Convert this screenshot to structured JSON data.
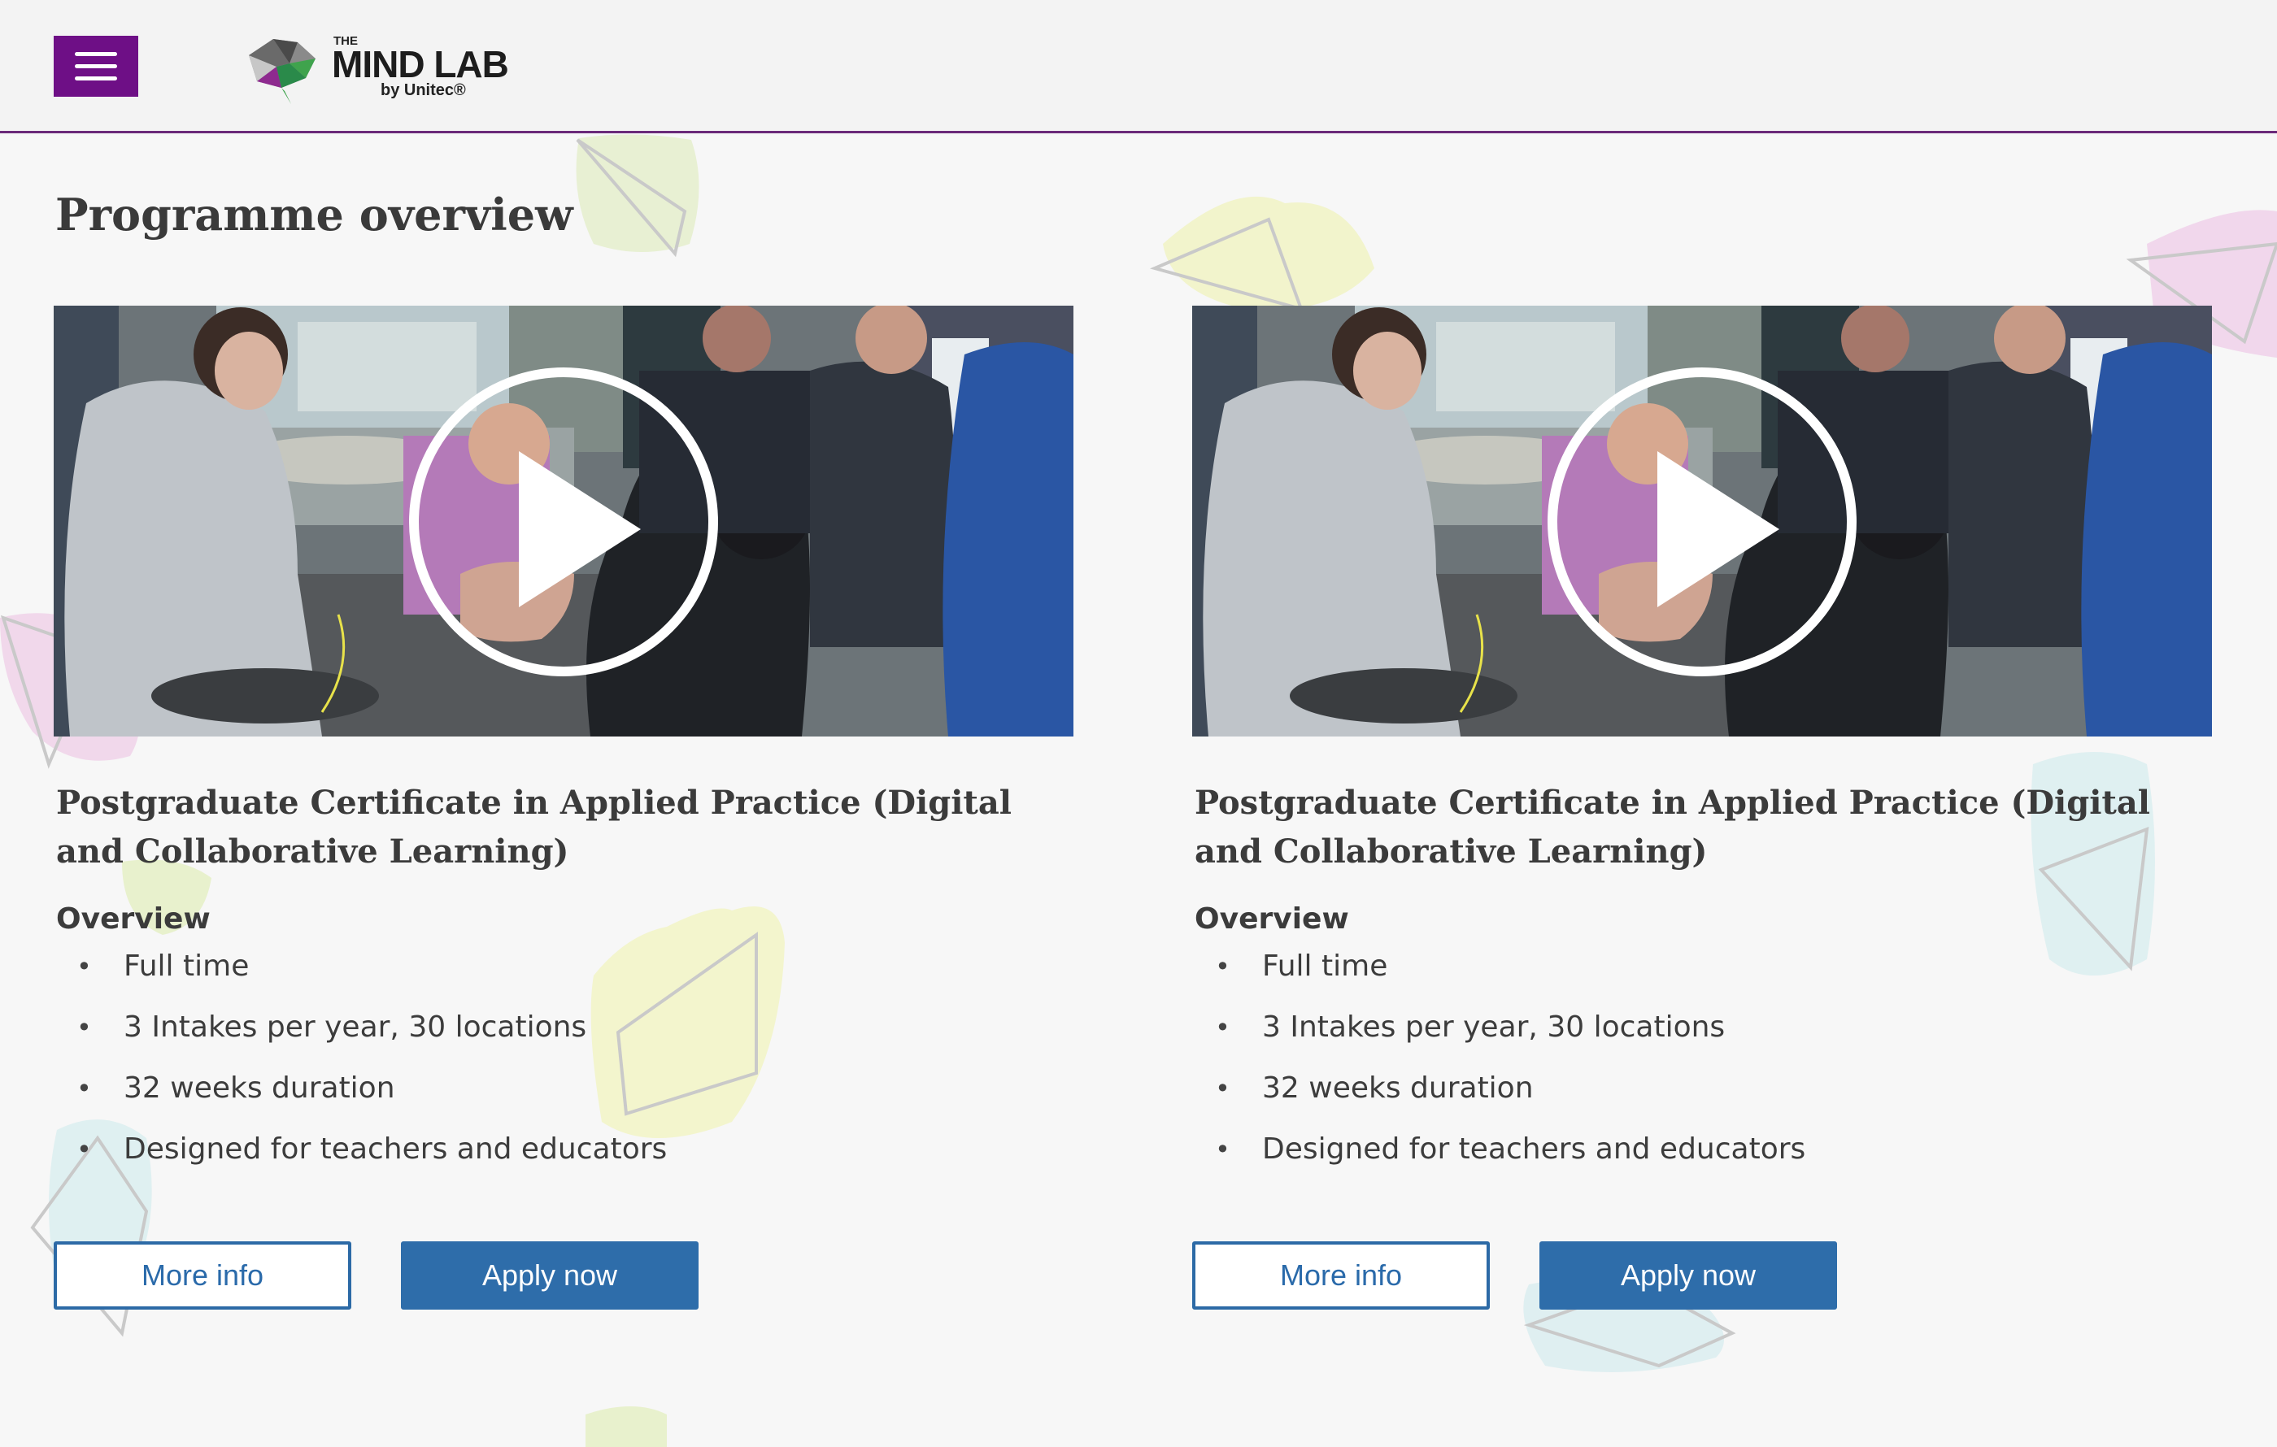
{
  "header": {
    "menu_icon": "hamburger-icon",
    "logo": {
      "the": "THE",
      "main": "MIND LAB",
      "sub": "by Unitec®"
    },
    "accent_color": "#6e0f86"
  },
  "page": {
    "title": "Programme overview"
  },
  "programmes": [
    {
      "title": "Postgraduate Certificate in Applied Practice (Digital and Collaborative Learning)",
      "overview_label": "Overview",
      "features": [
        "Full time",
        "3 Intakes per year, 30 locations",
        "32 weeks duration",
        "Designed for teachers and educators"
      ],
      "more_info_label": "More info",
      "apply_label": "Apply now",
      "video_icon": "play-icon"
    },
    {
      "title": "Postgraduate Certificate in Applied Practice (Digital and Collaborative Learning)",
      "overview_label": "Overview",
      "features": [
        "Full time",
        "3 Intakes per year, 30 locations",
        "32 weeks duration",
        "Designed for teachers and educators"
      ],
      "more_info_label": "More info",
      "apply_label": "Apply now",
      "video_icon": "play-icon"
    }
  ],
  "colors": {
    "button_primary": "#2e6daa",
    "heading": "#3a3a3a"
  }
}
